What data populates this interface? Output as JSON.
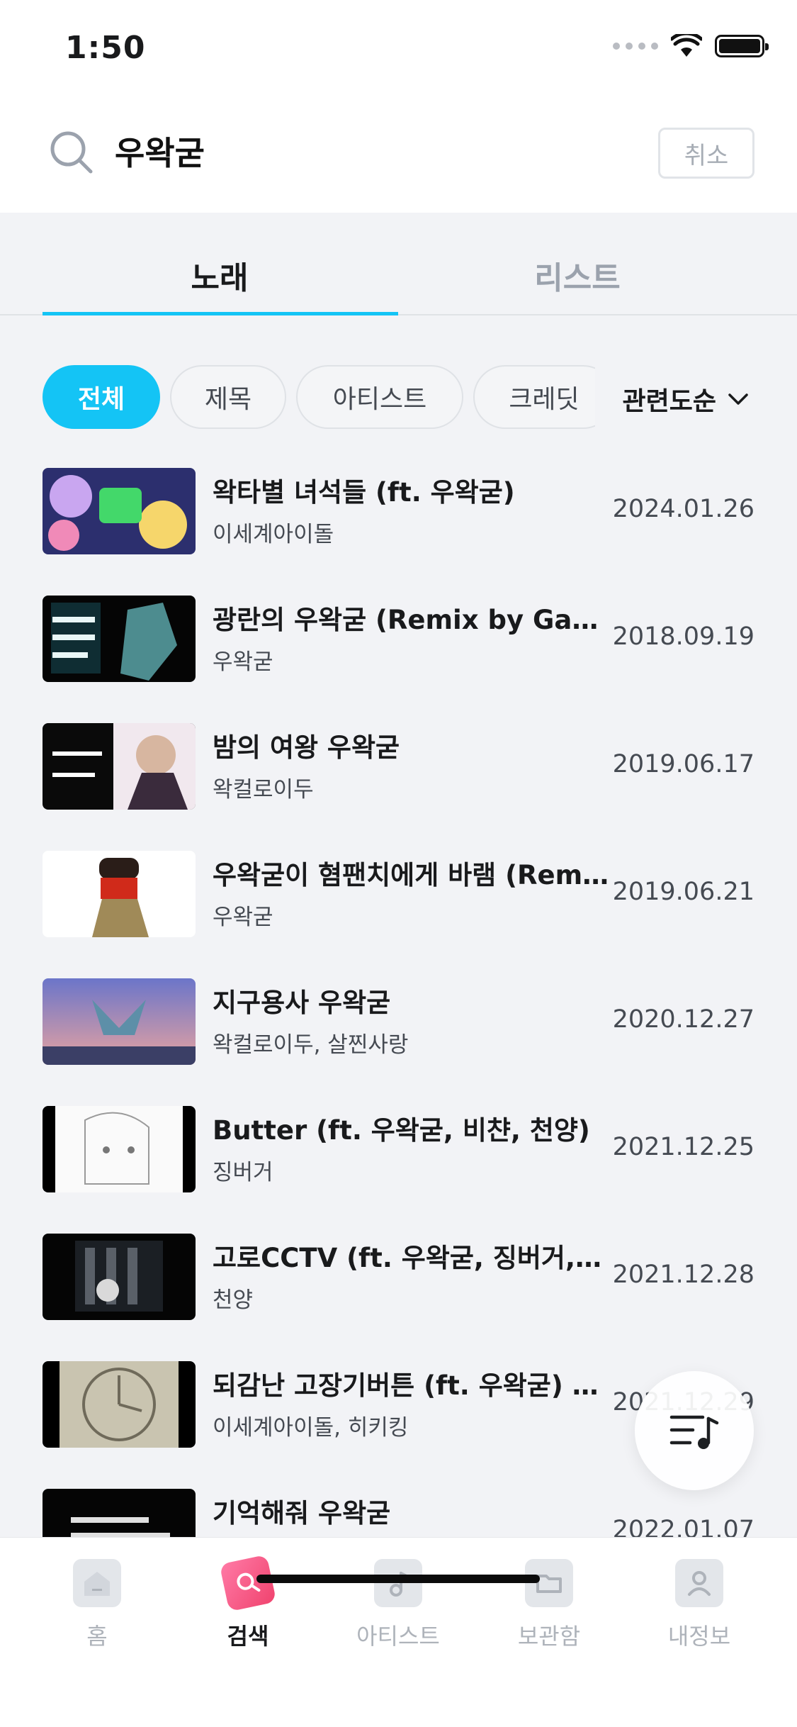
{
  "status_bar": {
    "time": "1:50"
  },
  "search": {
    "query": "우왁굳",
    "cancel_label": "취소"
  },
  "tabs": [
    {
      "label": "노래",
      "active": true
    },
    {
      "label": "리스트",
      "active": false
    }
  ],
  "filters": {
    "chips": [
      {
        "label": "전체",
        "active": true
      },
      {
        "label": "제목",
        "active": false
      },
      {
        "label": "아티스트",
        "active": false
      },
      {
        "label": "크레딧",
        "active": false
      }
    ],
    "sort_label": "관련도순"
  },
  "songs": [
    {
      "title": "왁타별 녀석들 (ft. 우왁굳)",
      "artist": "이세계아이돌",
      "date": "2024.01.26"
    },
    {
      "title": "광란의 우왁굳 (Remix by Gark)",
      "artist": "우왁굳",
      "date": "2018.09.19"
    },
    {
      "title": "밤의 여왕 우왁굳",
      "artist": "왁컬로이두",
      "date": "2019.06.17"
    },
    {
      "title": "우왁굳이 혐팬치에게 바램 (Remi...",
      "artist": "우왁굳",
      "date": "2019.06.21"
    },
    {
      "title": "지구용사 우왁굳",
      "artist": "왁컬로이두, 살찐사랑",
      "date": "2020.12.27"
    },
    {
      "title": "Butter (ft. 우왁굳, 비챤, 천양)",
      "artist": "징버거",
      "date": "2021.12.25"
    },
    {
      "title": "고로CCTV (ft. 우왁굳, 징버거, 고...",
      "artist": "천양",
      "date": "2021.12.28"
    },
    {
      "title": "되감난 고장기버튼 (ft. 우왁굳) (R...",
      "artist": "이세계아이돌, 히키킹",
      "date": "2021.12.29"
    },
    {
      "title": "기억해줘 우왁굳",
      "artist": "",
      "date": "2022.01.07"
    }
  ],
  "bottom_nav": [
    {
      "label": "홈",
      "icon": "home-icon",
      "active": false
    },
    {
      "label": "검색",
      "icon": "search-icon",
      "active": true
    },
    {
      "label": "아티스트",
      "icon": "music-note-icon",
      "active": false
    },
    {
      "label": "보관함",
      "icon": "folder-icon",
      "active": false
    },
    {
      "label": "내정보",
      "icon": "person-icon",
      "active": false
    }
  ],
  "colors": {
    "accent": "#14c4f5",
    "nav_active": "#f0436e"
  }
}
